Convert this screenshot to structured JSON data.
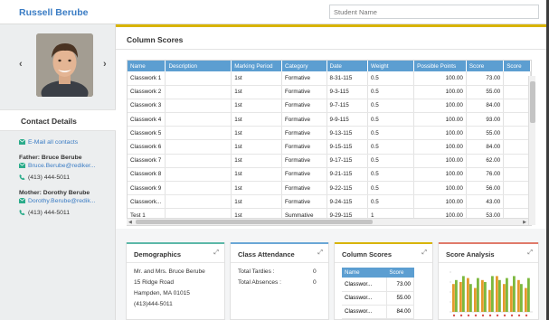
{
  "header": {
    "student_name": "Russell Berube",
    "search_placeholder": "Student Name"
  },
  "profile": {
    "prev_arrow": "‹",
    "next_arrow": "›"
  },
  "contact": {
    "title": "Contact Details",
    "email_all": "E-Mail all contacts",
    "father_label": "Father: Bruce Berube",
    "father_email": "Bruce.Berube@rediker...",
    "father_phone": "(413) 444-5011",
    "mother_label": "Mother: Dorothy Berube",
    "mother_email": "Dorothy.Berube@redik...",
    "mother_phone": "(413) 444-5011"
  },
  "column_scores": {
    "title": "Column Scores",
    "headers": [
      "Name",
      "Description",
      "Marking Period",
      "Category",
      "Date",
      "Weight",
      "Possible Points",
      "Score",
      "Score"
    ],
    "rows": [
      [
        "Classwork 1",
        "",
        "1st",
        "Formative",
        "8-31-115",
        "0.5",
        "100.00",
        "73.00",
        ""
      ],
      [
        "Classwork 2",
        "",
        "1st",
        "Formative",
        "9-3-115",
        "0.5",
        "100.00",
        "55.00",
        ""
      ],
      [
        "Classwork 3",
        "",
        "1st",
        "Formative",
        "9-7-115",
        "0.5",
        "100.00",
        "84.00",
        ""
      ],
      [
        "Classwork 4",
        "",
        "1st",
        "Formative",
        "9-9-115",
        "0.5",
        "100.00",
        "93.00",
        ""
      ],
      [
        "Classwork 5",
        "",
        "1st",
        "Formative",
        "9-13-115",
        "0.5",
        "100.00",
        "55.00",
        ""
      ],
      [
        "Classwork 6",
        "",
        "1st",
        "Formative",
        "9-15-115",
        "0.5",
        "100.00",
        "84.00",
        ""
      ],
      [
        "Classwork 7",
        "",
        "1st",
        "Formative",
        "9-17-115",
        "0.5",
        "100.00",
        "62.00",
        ""
      ],
      [
        "Classwork 8",
        "",
        "1st",
        "Formative",
        "9-21-115",
        "0.5",
        "100.00",
        "76.00",
        ""
      ],
      [
        "Classwork 9",
        "",
        "1st",
        "Formative",
        "9-22-115",
        "0.5",
        "100.00",
        "56.00",
        ""
      ],
      [
        "Classwork...",
        "",
        "1st",
        "Formative",
        "9-24-115",
        "0.5",
        "100.00",
        "43.00",
        ""
      ],
      [
        "Test 1",
        "",
        "1st",
        "Summative",
        "9-29-115",
        "1",
        "100.00",
        "53.00",
        ""
      ]
    ]
  },
  "widgets": {
    "demographics": {
      "title": "Demographics",
      "lines": [
        "Mr. and Mrs. Bruce Berube",
        "15 Ridge Road",
        "Hampden, MA 01015",
        "(413)444-5011"
      ]
    },
    "attendance": {
      "title": "Class Attendance",
      "tardies_label": "Total Tardies :",
      "tardies_value": "0",
      "absences_label": "Total Absences :",
      "absences_value": "0"
    },
    "mini_scores": {
      "title": "Column Scores",
      "headers": [
        "Name",
        "Score"
      ],
      "rows": [
        [
          "Classwor...",
          "73.00"
        ],
        [
          "Classwor...",
          "55.00"
        ],
        [
          "Classwor...",
          "84.00"
        ]
      ]
    },
    "score_analysis": {
      "title": "Score Analysis"
    }
  },
  "chart_data": {
    "type": "bar",
    "series": [
      {
        "values": [
          0.7,
          0.75,
          0.85,
          0.6,
          0.8,
          0.55,
          0.9,
          0.7,
          0.65,
          0.8,
          0.6
        ]
      },
      {
        "values": [
          0.8,
          0.9,
          0.7,
          0.85,
          0.75,
          0.9,
          0.8,
          0.85,
          0.9,
          0.7,
          0.85
        ]
      }
    ],
    "colors": [
      "#e59a2c",
      "#7cb83e",
      "#d9534f"
    ]
  },
  "accent": {
    "demographics": "#5cb8a8",
    "attendance": "#6aa7d6",
    "mini_scores": "#d8b400",
    "score_analysis": "#e07a6a"
  }
}
